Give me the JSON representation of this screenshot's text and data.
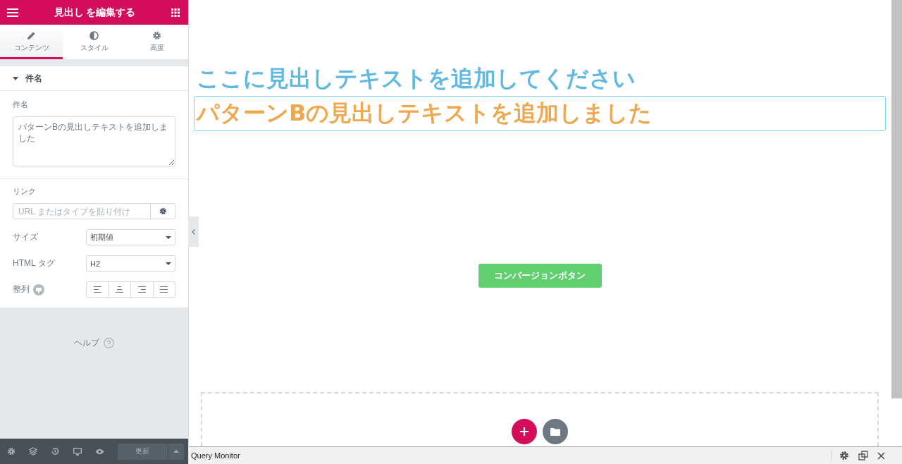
{
  "panel": {
    "title": "見出し を編集する",
    "tabs": [
      {
        "label": "コンテンツ",
        "selected": true
      },
      {
        "label": "スタイル",
        "selected": false
      },
      {
        "label": "高度",
        "selected": false
      }
    ],
    "section": {
      "title": "件名",
      "expanded": true
    },
    "title_field": {
      "label": "件名",
      "value": "パターンBの見出しテキストを追加しました"
    },
    "link_field": {
      "label": "リンク",
      "placeholder": "URL またはタイプを貼り付け"
    },
    "size_select": {
      "label": "サイズ",
      "value": "初期値"
    },
    "tag_select": {
      "label": "HTML タグ",
      "value": "H2"
    },
    "alignment": {
      "label": "整列",
      "options": [
        {
          "kind": "left",
          "selected": false
        },
        {
          "kind": "center",
          "selected": false
        },
        {
          "kind": "right",
          "selected": false
        },
        {
          "kind": "justify",
          "selected": false
        }
      ]
    },
    "help": "ヘルプ",
    "footer": {
      "update_button": "更新"
    }
  },
  "canvas": {
    "headings": [
      {
        "text": "ここに見出しテキストを追加してください",
        "color": "#61b8e1",
        "selected": false
      },
      {
        "text": "パターンBの見出しテキストを追加しました",
        "color": "#efa84f",
        "selected": true
      }
    ],
    "button": "コンバージョンボタン"
  },
  "query_monitor": {
    "title": "Query Monitor"
  }
}
